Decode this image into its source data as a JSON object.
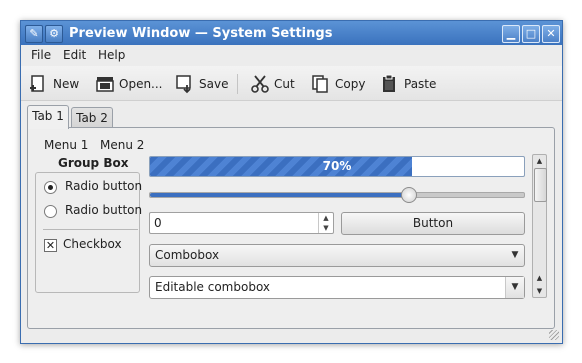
{
  "window": {
    "title": "Preview Window — System Settings",
    "controls": {
      "minimize": "▁",
      "maximize": "□",
      "close": "✕"
    }
  },
  "menubar": {
    "items": [
      {
        "label": "File"
      },
      {
        "label": "Edit"
      },
      {
        "label": "Help"
      }
    ]
  },
  "toolbar": {
    "new_label": "New",
    "open_label": "Open...",
    "save_label": "Save",
    "cut_label": "Cut",
    "copy_label": "Copy",
    "paste_label": "Paste"
  },
  "tabs": [
    {
      "label": "Tab 1",
      "active": true
    },
    {
      "label": "Tab 2",
      "active": false
    }
  ],
  "panel": {
    "inner_menu": [
      {
        "label": "Menu 1"
      },
      {
        "label": "Menu 2"
      }
    ],
    "group_box": {
      "title": "Group Box",
      "radio1_label": "Radio button",
      "radio1_checked": true,
      "radio2_label": "Radio button",
      "radio2_checked": false,
      "checkbox_label": "Checkbox",
      "checkbox_checked": true
    },
    "progress": {
      "text": "70%",
      "value": 0.7
    },
    "slider": {
      "value": 0.7
    },
    "spinbox": {
      "value": "0"
    },
    "button": {
      "label": "Button"
    },
    "combobox": {
      "value": "Combobox"
    },
    "editable_combobox": {
      "value": "Editable combobox"
    }
  },
  "colors": {
    "accent": "#3b6fc0",
    "titlebar": "#4a82c9"
  }
}
